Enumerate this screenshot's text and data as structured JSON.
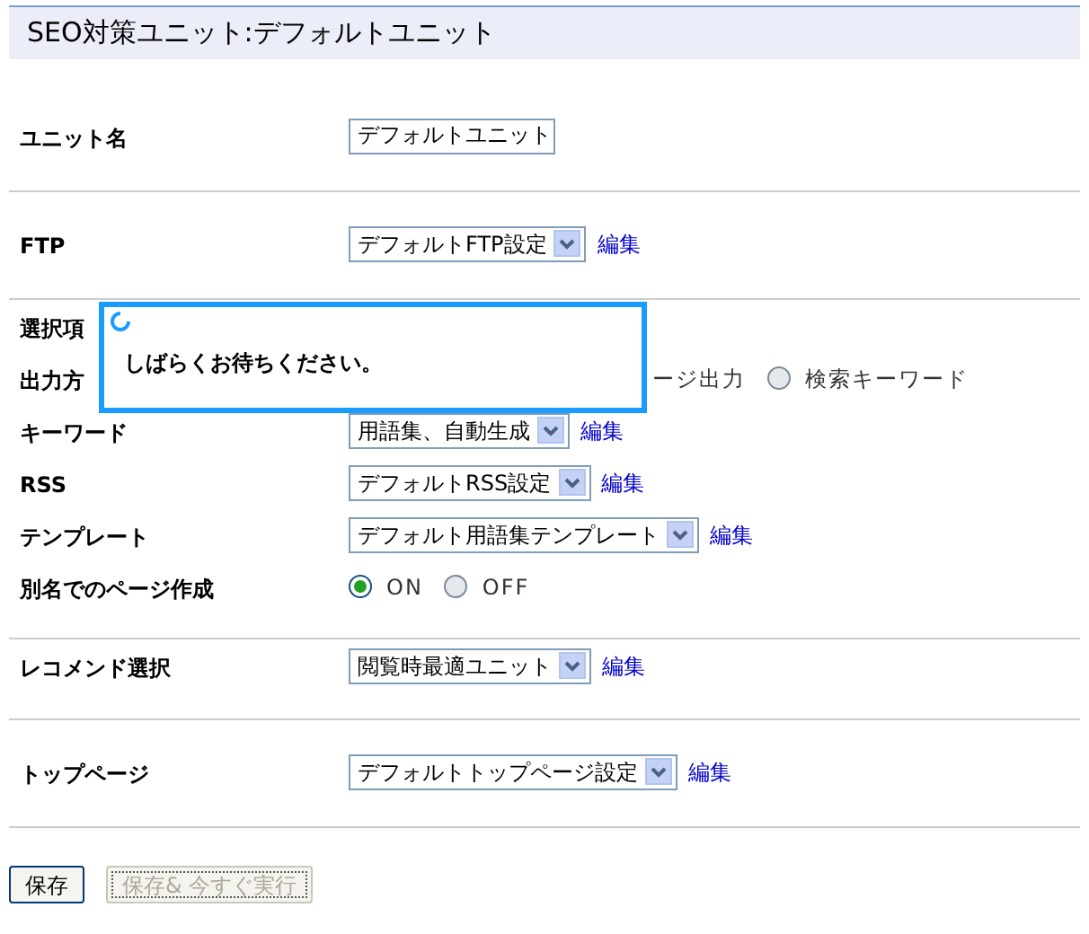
{
  "title": "SEO対策ユニット:デフォルトユニット",
  "sections": [
    {
      "rows": [
        {
          "label": "ユニット名",
          "kind": "text",
          "value": "デフォルトユニット"
        }
      ]
    },
    {
      "rows": [
        {
          "label": "FTP",
          "kind": "select",
          "value": "デフォルトFTP設定",
          "link": "編集"
        }
      ]
    },
    {
      "rows": [
        {
          "label": "選択項",
          "kind": "none"
        },
        {
          "label": "出力方",
          "kind": "radios",
          "options": [
            {
              "label": "ージ出力"
            },
            {
              "label": "検索キーワード",
              "selected": false
            }
          ]
        },
        {
          "label": "キーワード",
          "kind": "select",
          "value": "用語集、自動生成",
          "link": "編集"
        },
        {
          "label": "RSS",
          "kind": "select",
          "value": "デフォルトRSS設定",
          "link": "編集"
        },
        {
          "label": "テンプレート",
          "kind": "select",
          "value": "デフォルト用語集テンプレート",
          "link": "編集"
        },
        {
          "label": "別名でのページ作成",
          "kind": "radios",
          "options": [
            {
              "label": "ON",
              "selected": true
            },
            {
              "label": "OFF",
              "selected": false
            }
          ]
        }
      ]
    },
    {
      "rows": [
        {
          "label": "レコメンド選択",
          "kind": "select",
          "value": "閲覧時最適ユニット",
          "link": "編集"
        }
      ]
    },
    {
      "rows": [
        {
          "label": "トップページ",
          "kind": "select",
          "value": "デフォルトトップページ設定",
          "link": "編集"
        }
      ]
    }
  ],
  "buttons": [
    {
      "label": "保存",
      "disabled": false
    },
    {
      "label": "保存& 今すぐ実行",
      "disabled": true
    }
  ],
  "overlay": {
    "message": "しばらくお待ちください。"
  }
}
